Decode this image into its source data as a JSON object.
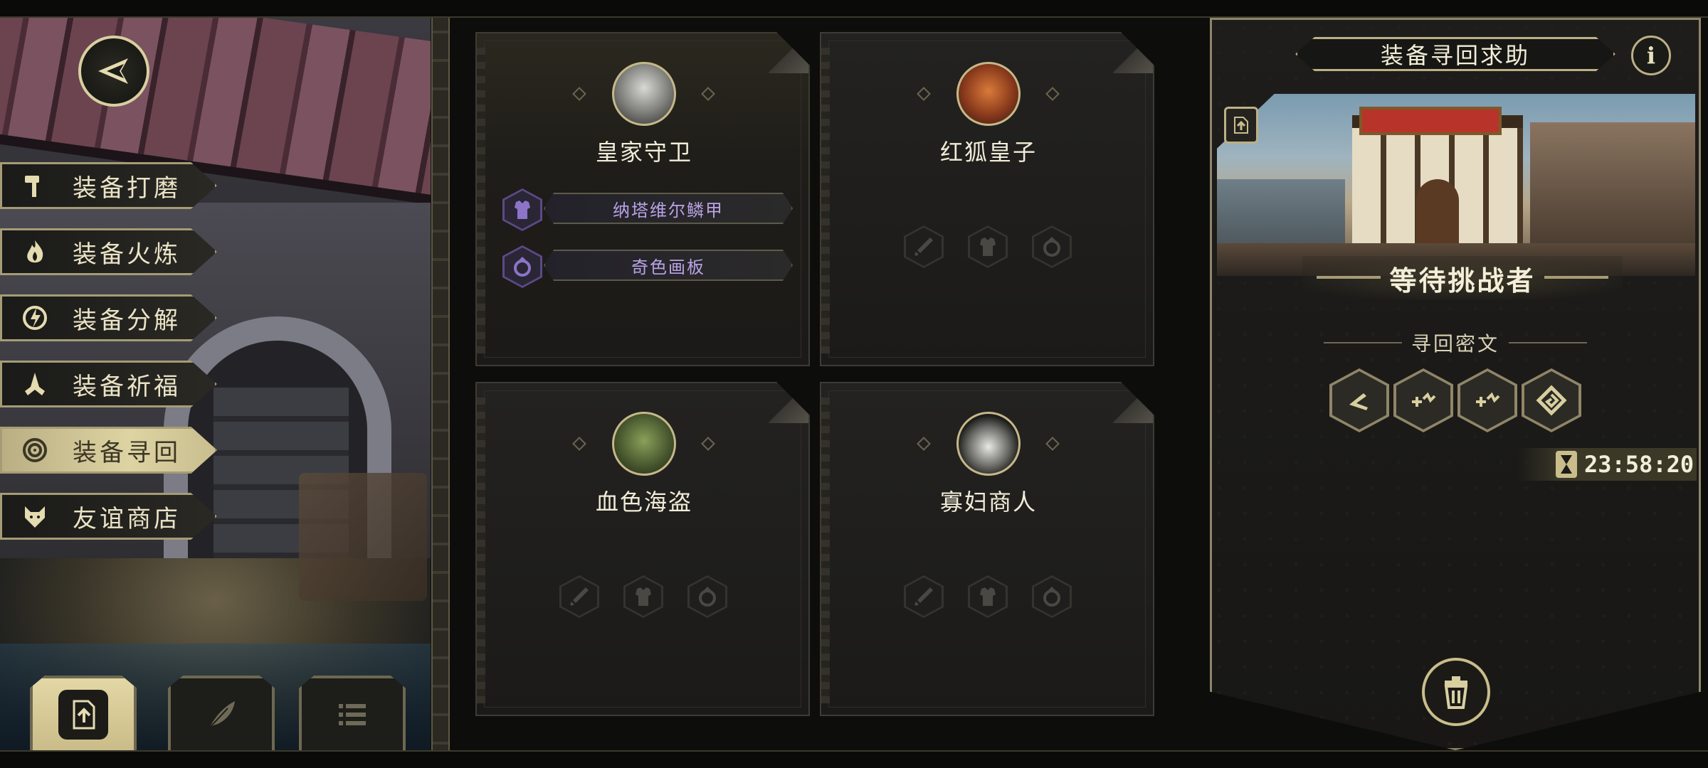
{
  "menu": {
    "items": [
      {
        "label": "装备打磨",
        "icon": "hammer-icon"
      },
      {
        "label": "装备火炼",
        "icon": "flame-icon"
      },
      {
        "label": "装备分解",
        "icon": "disassemble-icon"
      },
      {
        "label": "装备祈福",
        "icon": "prayer-hands-icon"
      },
      {
        "label": "装备寻回",
        "icon": "target-icon"
      },
      {
        "label": "友谊商店",
        "icon": "fox-icon"
      }
    ],
    "active_index": 4
  },
  "bottom_buttons": [
    {
      "icon": "upload-icon"
    },
    {
      "icon": "feather-icon"
    },
    {
      "icon": "list-icon"
    }
  ],
  "cards": [
    {
      "name": "皇家守卫",
      "portrait": "knight-portrait",
      "items": [
        {
          "slot_icon": "armor-icon",
          "label": "纳塔维尔鳞甲"
        },
        {
          "slot_icon": "ring-icon",
          "label": "奇色画板"
        }
      ]
    },
    {
      "name": "红狐皇子",
      "portrait": "fox-prince-portrait",
      "items": []
    },
    {
      "name": "血色海盗",
      "portrait": "lizard-pirate-portrait",
      "items": []
    },
    {
      "name": "寡妇商人",
      "portrait": "widow-merchant-portrait",
      "items": []
    }
  ],
  "right_panel": {
    "title": "装备寻回求助",
    "status": "等待挑战者",
    "section_label": "寻回密文",
    "runes": [
      "rune-1-icon",
      "rune-2-icon",
      "rune-3-icon",
      "rune-4-icon"
    ],
    "timer": "23:58:20"
  },
  "colors": {
    "gold": "#c9bd8c",
    "item_purple": "#b9a3e6",
    "text_light": "#f1ecd8"
  }
}
